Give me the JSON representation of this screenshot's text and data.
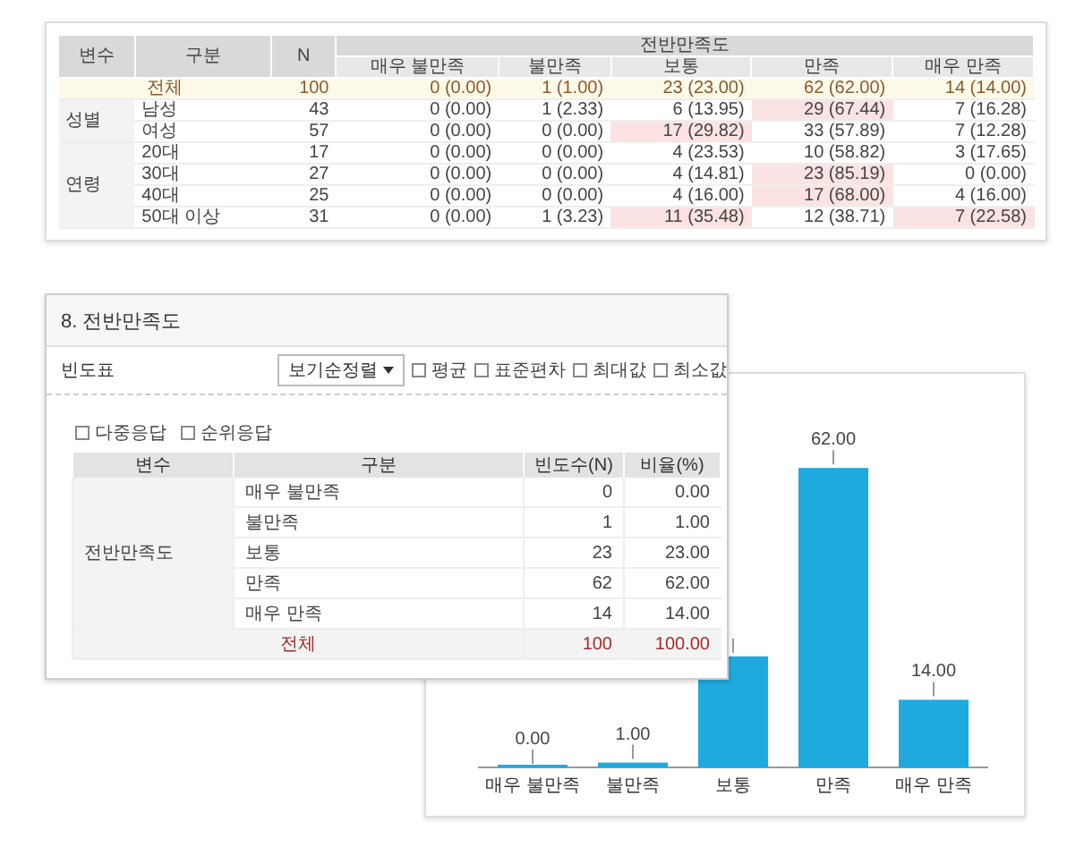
{
  "crosstab": {
    "columns": [
      "변수",
      "구분",
      "N"
    ],
    "group_header": "전반만족도",
    "subcolumns": [
      "매우 불만족",
      "불만족",
      "보통",
      "만족",
      "매우 만족"
    ],
    "total": {
      "label": "전체",
      "n": "100",
      "cells": [
        "0 (0.00)",
        "1 (1.00)",
        "23 (23.00)",
        "62 (62.00)",
        "14 (14.00)"
      ]
    },
    "groups": [
      {
        "name": "성별",
        "rows": [
          {
            "label": "남성",
            "n": "43",
            "cells": [
              {
                "text": "0 (0.00)",
                "highlighted": false
              },
              {
                "text": "1 (2.33)",
                "highlighted": false
              },
              {
                "text": "6 (13.95)",
                "highlighted": false
              },
              {
                "text": "29 (67.44)",
                "highlighted": true
              },
              {
                "text": "7 (16.28)",
                "highlighted": false
              }
            ]
          },
          {
            "label": "여성",
            "n": "57",
            "cells": [
              {
                "text": "0 (0.00)",
                "highlighted": false
              },
              {
                "text": "0 (0.00)",
                "highlighted": false
              },
              {
                "text": "17 (29.82)",
                "highlighted": true
              },
              {
                "text": "33 (57.89)",
                "highlighted": false
              },
              {
                "text": "7 (12.28)",
                "highlighted": false
              }
            ]
          }
        ]
      },
      {
        "name": "연령",
        "rows": [
          {
            "label": "20대",
            "n": "17",
            "cells": [
              {
                "text": "0 (0.00)",
                "highlighted": false
              },
              {
                "text": "0 (0.00)",
                "highlighted": false
              },
              {
                "text": "4 (23.53)",
                "highlighted": false
              },
              {
                "text": "10 (58.82)",
                "highlighted": false
              },
              {
                "text": "3 (17.65)",
                "highlighted": false
              }
            ]
          },
          {
            "label": "30대",
            "n": "27",
            "cells": [
              {
                "text": "0 (0.00)",
                "highlighted": false
              },
              {
                "text": "0 (0.00)",
                "highlighted": false
              },
              {
                "text": "4 (14.81)",
                "highlighted": false
              },
              {
                "text": "23 (85.19)",
                "highlighted": true
              },
              {
                "text": "0 (0.00)",
                "highlighted": false
              }
            ]
          },
          {
            "label": "40대",
            "n": "25",
            "cells": [
              {
                "text": "0 (0.00)",
                "highlighted": false
              },
              {
                "text": "0 (0.00)",
                "highlighted": false
              },
              {
                "text": "4 (16.00)",
                "highlighted": false
              },
              {
                "text": "17 (68.00)",
                "highlighted": true
              },
              {
                "text": "4 (16.00)",
                "highlighted": false
              }
            ]
          },
          {
            "label": "50대 이상",
            "n": "31",
            "cells": [
              {
                "text": "0 (0.00)",
                "highlighted": false
              },
              {
                "text": "1 (3.23)",
                "highlighted": false
              },
              {
                "text": "11 (35.48)",
                "highlighted": true
              },
              {
                "text": "12 (38.71)",
                "highlighted": false
              },
              {
                "text": "7 (22.58)",
                "highlighted": true
              }
            ]
          }
        ]
      }
    ]
  },
  "frequency_panel": {
    "title": "8. 전반만족도",
    "section": "빈도표",
    "sort_button": "보기순정렬",
    "stat_options": [
      {
        "label": "평균",
        "checked": false
      },
      {
        "label": "표준편차",
        "checked": false
      },
      {
        "label": "최대값",
        "checked": false
      },
      {
        "label": "최소값",
        "checked": false
      }
    ],
    "response_options": [
      {
        "label": "다중응답",
        "checked": false
      },
      {
        "label": "순위응답",
        "checked": false
      }
    ],
    "table": {
      "columns": [
        "변수",
        "구분",
        "빈도수(N)",
        "비율(%)"
      ],
      "variable": "전반만족도",
      "rows": [
        {
          "label": "매우 불만족",
          "count": "0",
          "percent": "0.00"
        },
        {
          "label": "불만족",
          "count": "1",
          "percent": "1.00"
        },
        {
          "label": "보통",
          "count": "23",
          "percent": "23.00"
        },
        {
          "label": "만족",
          "count": "62",
          "percent": "62.00"
        },
        {
          "label": "매우 만족",
          "count": "14",
          "percent": "14.00"
        }
      ],
      "total": {
        "label": "전체",
        "count": "100",
        "percent": "100.00"
      }
    }
  },
  "chart_panel": {
    "chart_data": {
      "type": "bar",
      "categories": [
        "매우 불만족",
        "불만족",
        "보통",
        "만족",
        "매우 만족"
      ],
      "series": [
        {
          "color": "#1eaadf",
          "values": [
            0,
            1,
            23,
            62,
            14
          ],
          "value_labels": [
            "0.00",
            "1.00",
            null,
            "62.00",
            "14.00"
          ]
        }
      ]
    }
  }
}
